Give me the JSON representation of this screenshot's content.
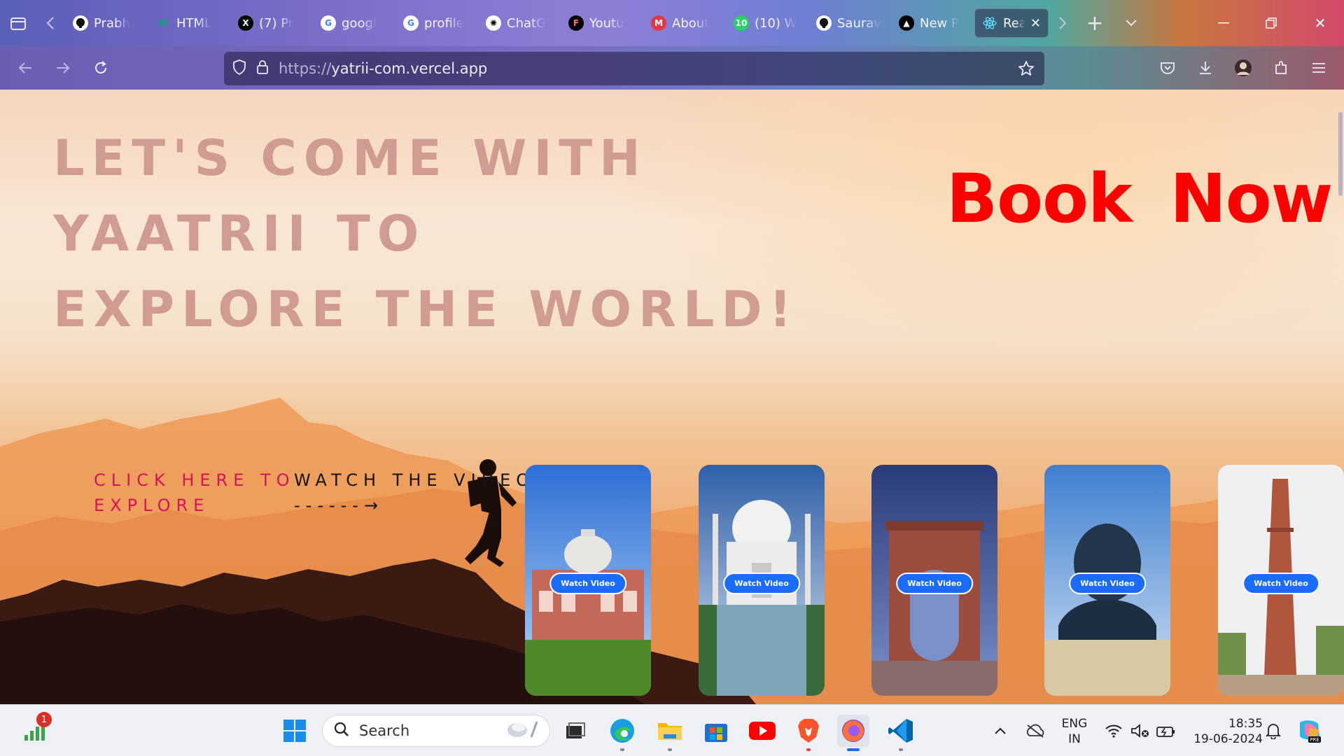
{
  "browser": {
    "tabs": [
      {
        "label": "Prabh",
        "icon": "github-icon",
        "icon_glyph": "",
        "icon_bg": "#ffffff",
        "icon_fg": "#000000"
      },
      {
        "label": "HTML",
        "icon": "w3schools-icon",
        "icon_glyph": "W",
        "icon_bg": "transparent",
        "icon_fg": "#04aa6d"
      },
      {
        "label": "(7) Pr",
        "icon": "x-icon",
        "icon_glyph": "X",
        "icon_bg": "#000000",
        "icon_fg": "#ffffff"
      },
      {
        "label": "googl",
        "icon": "google-icon",
        "icon_glyph": "G",
        "icon_bg": "#ffffff",
        "icon_fg": "#4285f4"
      },
      {
        "label": "profile",
        "icon": "google-icon",
        "icon_glyph": "G",
        "icon_bg": "#ffffff",
        "icon_fg": "#4285f4"
      },
      {
        "label": "ChatG",
        "icon": "chatgpt-icon",
        "icon_glyph": "✺",
        "icon_bg": "#ffffff",
        "icon_fg": "#000000"
      },
      {
        "label": "Youtu",
        "icon": "figma-icon",
        "icon_glyph": "F",
        "icon_bg": "#000000",
        "icon_fg": "#ff7262"
      },
      {
        "label": "About",
        "icon": "myntra-icon",
        "icon_glyph": "M",
        "icon_bg": "#e23744",
        "icon_fg": "#ffffff"
      },
      {
        "label": "(10) W",
        "icon": "whatsapp-icon",
        "icon_glyph": "10",
        "icon_bg": "#25d366",
        "icon_fg": "#ffffff"
      },
      {
        "label": "Saurav",
        "icon": "github-icon",
        "icon_glyph": "",
        "icon_bg": "#ffffff",
        "icon_fg": "#000000"
      },
      {
        "label": "New P",
        "icon": "vercel-icon",
        "icon_glyph": "▲",
        "icon_bg": "#000000",
        "icon_fg": "#ffffff"
      }
    ],
    "active_tab": {
      "label": "Rea",
      "icon": "react-icon"
    },
    "url_scheme": "https://",
    "url_host": "yatrii-com.vercel.app"
  },
  "page": {
    "hero_lines": [
      "LET'S COME WITH",
      "YAATRII TO",
      "EXPLORE THE WORLD!"
    ],
    "book_now": "Book Now",
    "cta_left": "CLICK HERE TO EXPLORE",
    "cta_right": "WATCH THE VIDEO",
    "cta_arrow": "------→",
    "cards": [
      {
        "name": "card-humayun-tomb",
        "button": "Watch Video"
      },
      {
        "name": "card-taj-mahal",
        "button": "Watch Video"
      },
      {
        "name": "card-india-gate",
        "button": "Watch Video"
      },
      {
        "name": "card-adiyogi",
        "button": "Watch Video"
      },
      {
        "name": "card-qutub-minar",
        "button": "Watch Video"
      }
    ],
    "colors": {
      "hero_text": "#cf9b93",
      "book_now": "#ff0000",
      "cta_pink": "#d4145a",
      "watch_button": "#1a6cff"
    }
  },
  "taskbar": {
    "search_placeholder": "Search",
    "notification_count": "1",
    "lang_primary": "ENG",
    "lang_secondary": "IN",
    "time": "18:35",
    "date": "19-06-2024"
  }
}
